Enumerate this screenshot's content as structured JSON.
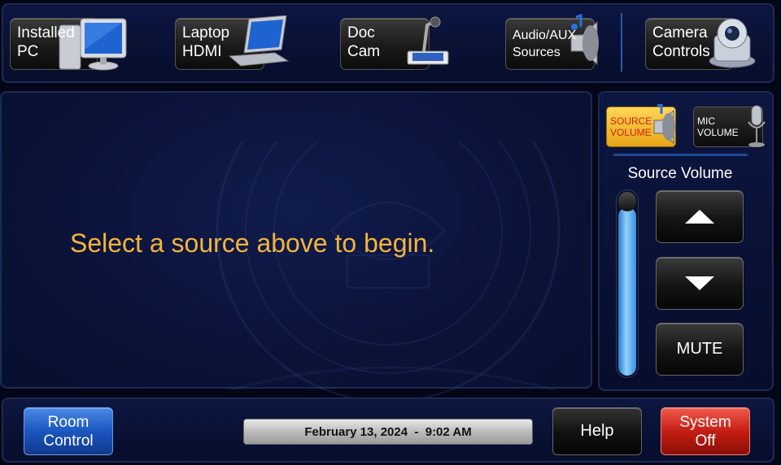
{
  "sources": [
    {
      "label": "Installed\nPC",
      "icon": "desktop-pc-icon"
    },
    {
      "label": "Laptop\nHDMI",
      "icon": "laptop-icon"
    },
    {
      "label": "Doc\nCam",
      "icon": "document-camera-icon"
    },
    {
      "label": "Audio/AUX\nSources",
      "icon": "speaker-icon"
    },
    {
      "label": "Camera\nControls",
      "icon": "ptz-camera-icon"
    }
  ],
  "main": {
    "prompt": "Select a source above to begin."
  },
  "volume": {
    "tab_source": "SOURCE\nVOLUME",
    "tab_mic": "MIC\nVOLUME",
    "title": "Source Volume",
    "level": 0.9,
    "mute_label": "MUTE"
  },
  "footer": {
    "room_control": "Room\nControl",
    "datetime": "February 13, 2024  -  9:02 AM",
    "help": "Help",
    "system_off": "System\nOff"
  },
  "colors": {
    "prompt": "#f4b43c",
    "active_tab": "#f0b428",
    "room_control": "#1a56c0",
    "system_off": "#c41e14"
  }
}
